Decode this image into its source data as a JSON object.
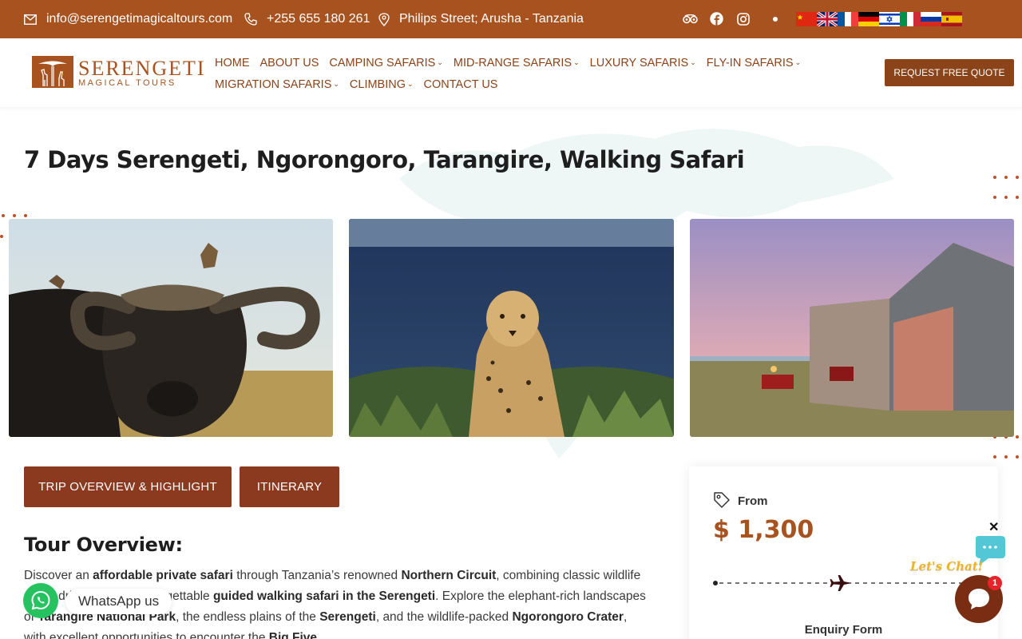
{
  "topbar": {
    "email": "info@serengetimagicaltours.com",
    "phone": "+255 655 180 261",
    "address": "Philips Street; Arusha - Tanzania",
    "socials": [
      "tripadvisor-icon",
      "facebook-icon",
      "instagram-icon"
    ],
    "flags": [
      "china",
      "united-kingdom",
      "france",
      "germany",
      "israel",
      "italy",
      "russia",
      "spain"
    ],
    "bg_color": "#a8531f"
  },
  "logo": {
    "title": "SERENGETI",
    "subtitle": "MAGICAL TOURS"
  },
  "nav": {
    "row1": [
      {
        "label": "HOME",
        "dropdown": false
      },
      {
        "label": "ABOUT US",
        "dropdown": false
      },
      {
        "label": "CAMPING SAFARIS",
        "dropdown": true
      },
      {
        "label": "MID-RANGE SAFARIS",
        "dropdown": true
      },
      {
        "label": "LUXURY SAFARIS",
        "dropdown": true
      },
      {
        "label": "FLY-IN SAFARIS",
        "dropdown": true
      }
    ],
    "row2": [
      {
        "label": "MIGRATION SAFARIS",
        "dropdown": true
      },
      {
        "label": "CLIMBING",
        "dropdown": true
      },
      {
        "label": "CONTACT US",
        "dropdown": false
      }
    ],
    "cta": "REQUEST FREE QUOTE"
  },
  "page": {
    "title": "7 Days Serengeti, Ngorongoro, Tarangire, Walking Safari"
  },
  "tabs": {
    "overview": "TRIP OVERVIEW & HIGHLIGHT",
    "itinerary": "ITINERARY"
  },
  "overview": {
    "heading": "Tour Overview:",
    "line1_a": "Discover an ",
    "line1_b": "affordable private safari",
    "line1_c": " through Tanzania’s renowned ",
    "line1_d": "Northern Circuit",
    "line1_e": ", combining classic wildlife",
    "line2_a": "game drives with an unforgettable ",
    "line2_b": "guided walking safari in the Serengeti",
    "line2_c": ". Explore the elephant-rich landscapes",
    "line3_a": "of ",
    "line3_b": "Tarangire National Park",
    "line3_c": ", the endless plains of the ",
    "line3_d": "Serengeti",
    "line3_e": ", and the wildlife-packed ",
    "line3_f": "Ngorongoro Crater",
    "line3_g": ",",
    "line4_a": "with excellent opportunities to encounter the ",
    "line4_b": "Big Five",
    "line4_c": "."
  },
  "price_card": {
    "from_label": "From",
    "price": "$ 1,300",
    "enquiry": "Enquiry Form"
  },
  "whatsapp": {
    "label": "WhatsApp us"
  },
  "chat": {
    "close": "✕",
    "tagline": "Let's Chat!",
    "badge": "1"
  },
  "colors": {
    "brand": "#a8531f",
    "button": "#8b3a1f",
    "whatsapp": "#25c25f",
    "chat": "#7a2d12"
  }
}
